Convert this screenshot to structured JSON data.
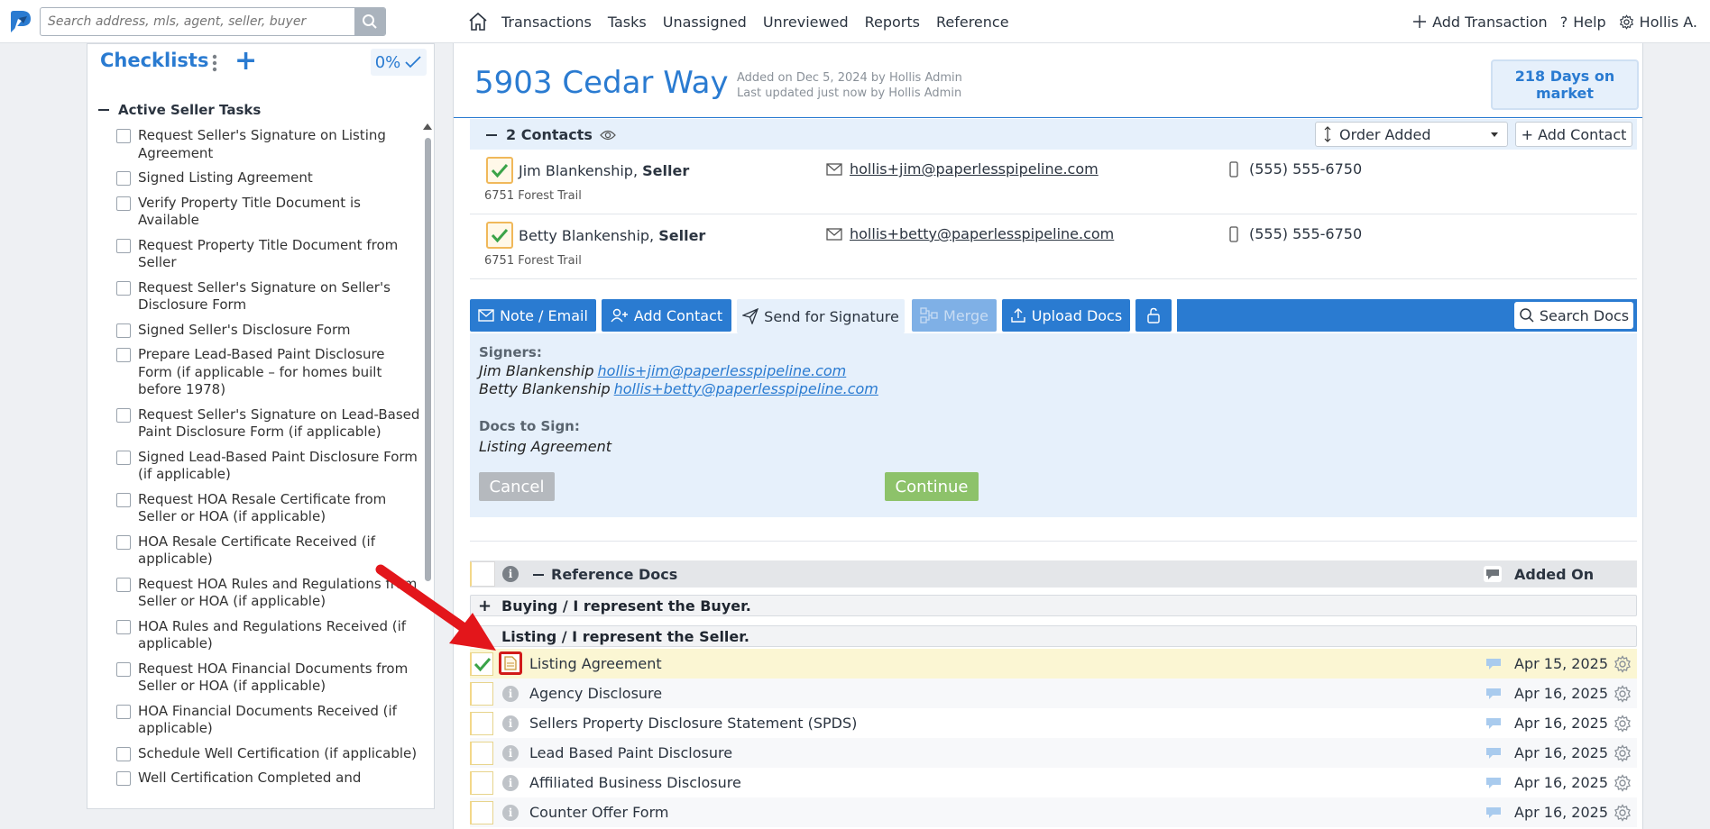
{
  "search": {
    "placeholder": "Search address, mls, agent, seller, buyer"
  },
  "nav": {
    "links": [
      "Transactions",
      "Tasks",
      "Unassigned",
      "Unreviewed",
      "Reports",
      "Reference"
    ],
    "add_transaction": "Add Transaction",
    "help": "Help",
    "user": "Hollis A."
  },
  "checklists": {
    "title": "Checklists",
    "progress": "0%",
    "group": "Active Seller Tasks",
    "items": [
      "Request Seller's Signature on Listing Agreement",
      "Signed Listing Agreement",
      "Verify Property Title Document is Available",
      "Request Property Title Document from Seller",
      "Request Seller's Signature on Seller's Disclosure Form",
      "Signed Seller's Disclosure Form",
      "Prepare Lead-Based Paint Disclosure Form (if applicable – for homes built before 1978)",
      "Request Seller's Signature on Lead-Based Paint Disclosure Form (if applicable)",
      "Signed Lead-Based Paint Disclosure Form (if applicable)",
      "Request HOA Resale Certificate from Seller or HOA (if applicable)",
      "HOA Resale Certificate Received (if applicable)",
      "Request HOA Rules and Regulations from Seller or HOA (if applicable)",
      "HOA Rules and Regulations Received (if applicable)",
      "Request HOA Financial Documents from Seller or HOA (if applicable)",
      "HOA Financial Documents Received (if applicable)",
      "Schedule Well Certification (if applicable)",
      "Well Certification Completed and"
    ]
  },
  "transaction": {
    "address": "5903 Cedar Way",
    "added_on": "Added on Dec 5, 2024 by Hollis Admin",
    "updated": "Last updated just now by Hollis Admin",
    "days_on_market": "218 Days on market"
  },
  "contacts": {
    "header": "2 Contacts",
    "order_label": "Order Added",
    "add_label": "+ Add Contact",
    "rows": [
      {
        "name": "Jim Blankenship,",
        "role": "Seller",
        "street": "6751 Forest Trail",
        "email": "hollis+jim@paperlesspipeline.com",
        "phone": "(555) 555-6750"
      },
      {
        "name": "Betty Blankenship,",
        "role": "Seller",
        "street": "6751 Forest Trail",
        "email": "hollis+betty@paperlesspipeline.com",
        "phone": "(555) 555-6750"
      }
    ]
  },
  "toolbar": {
    "note_email": "Note / Email",
    "add_contact": "Add Contact",
    "send_signature": "Send for Signature",
    "merge": "Merge",
    "upload_docs": "Upload Docs",
    "search_docs": "Search Docs"
  },
  "signature": {
    "signers_label": "Signers:",
    "signers": [
      {
        "name": "Jim Blankenship",
        "email": "hollis+jim@paperlesspipeline.com"
      },
      {
        "name": "Betty Blankenship",
        "email": "hollis+betty@paperlesspipeline.com"
      }
    ],
    "docs_label": "Docs to Sign:",
    "doc": "Listing Agreement",
    "cancel": "Cancel",
    "continue": "Continue"
  },
  "docs": {
    "header": "Reference Docs",
    "added_on": "Added On",
    "folder_buyer": "Buying / I represent the Buyer.",
    "folder_seller": "Listing / I represent the Seller.",
    "rows": [
      {
        "name": "Listing Agreement",
        "date": "Apr 15, 2025"
      },
      {
        "name": "Agency Disclosure",
        "date": "Apr 16, 2025"
      },
      {
        "name": "Sellers Property Disclosure Statement (SPDS)",
        "date": "Apr 16, 2025"
      },
      {
        "name": "Lead Based Paint Disclosure",
        "date": "Apr 16, 2025"
      },
      {
        "name": "Affiliated Business Disclosure",
        "date": "Apr 16, 2025"
      },
      {
        "name": "Counter Offer Form",
        "date": "Apr 16, 2025"
      }
    ]
  },
  "colors": {
    "brand": "#2a7bd1",
    "highlight": "#fbf6d3",
    "annotation": "#e3161b"
  }
}
